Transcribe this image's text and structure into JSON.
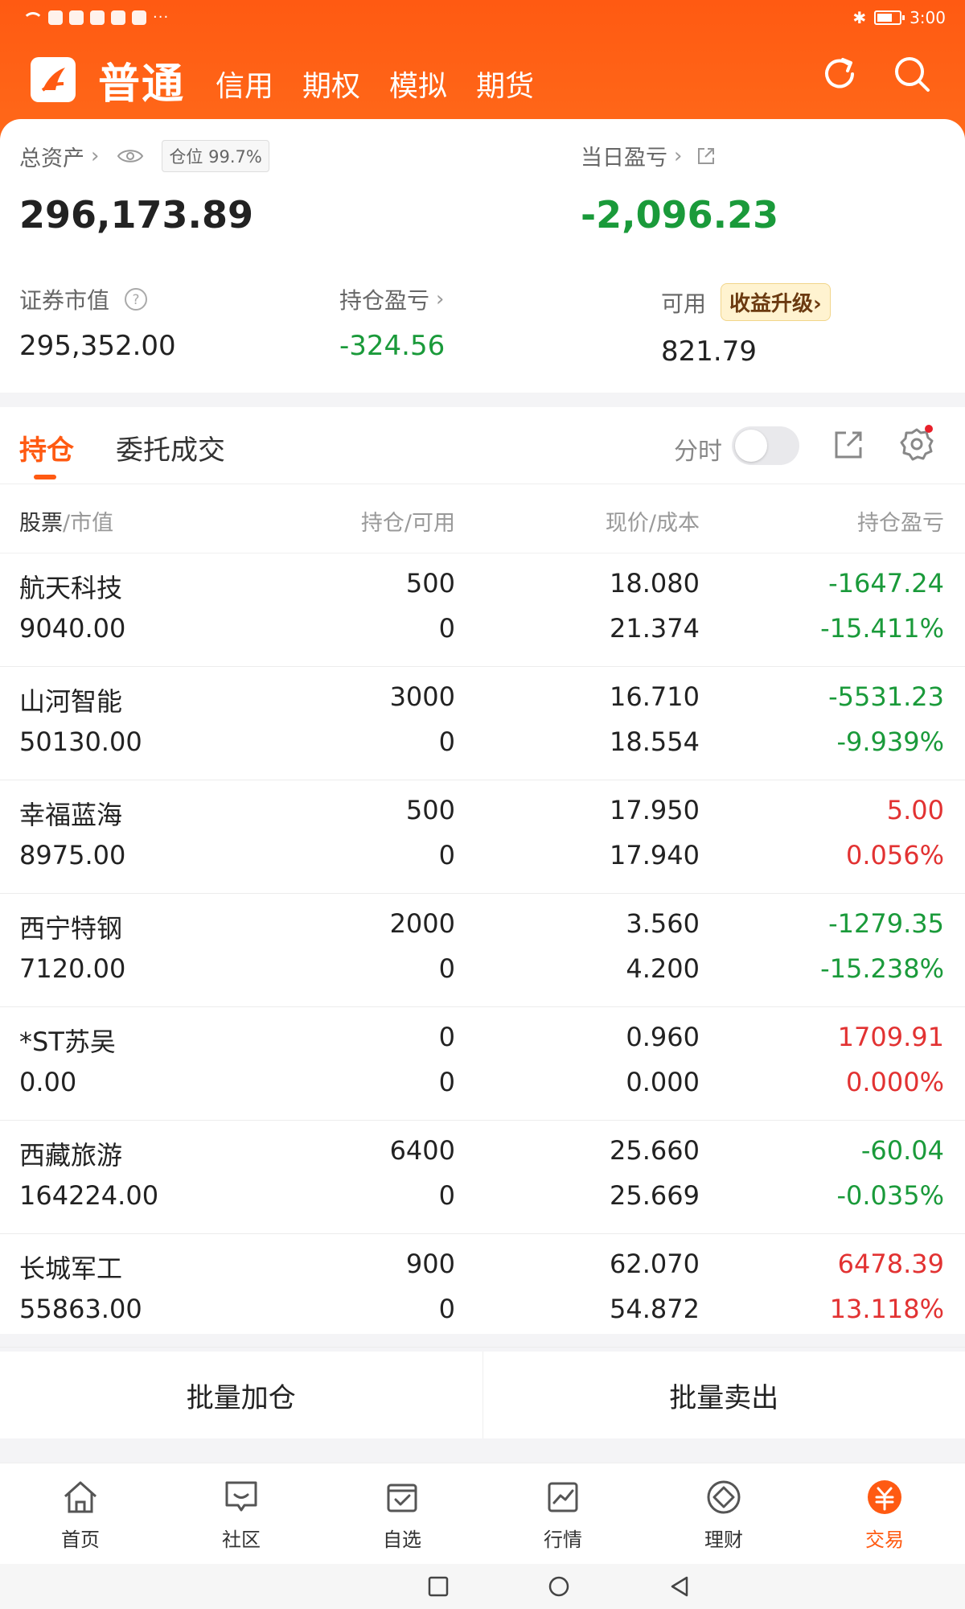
{
  "status_bar": {
    "time": "3:00",
    "dots": "···"
  },
  "nav": {
    "main": "普通",
    "tabs": [
      "信用",
      "期权",
      "模拟",
      "期货"
    ]
  },
  "account": {
    "total_assets_label": "总资产",
    "position_label": "仓位",
    "position_value": "99.7%",
    "total_assets_value": "296,173.89",
    "daily_pnl_label": "当日盈亏",
    "daily_pnl_value": "-2,096.23",
    "market_value_label": "证券市值",
    "market_value": "295,352.00",
    "holding_pnl_label": "持仓盈亏",
    "holding_pnl_value": "-324.56",
    "available_label": "可用",
    "available_value": "821.79",
    "upgrade_label": "收益升级"
  },
  "positions": {
    "tabs": [
      "持仓",
      "委托成交"
    ],
    "intraday_label": "分时",
    "columns": {
      "stock_part1": "股票",
      "stock_part2": "/市值",
      "holding": "持仓/可用",
      "price": "现价/成本",
      "pnl": "持仓盈亏"
    },
    "rows": [
      {
        "name": "航天科技",
        "market_value": "9040.00",
        "holding": "500",
        "available": "0",
        "price": "18.080",
        "cost": "21.374",
        "pnl": "-1647.24",
        "pnl_pct": "-15.411%",
        "direction": "down"
      },
      {
        "name": "山河智能",
        "market_value": "50130.00",
        "holding": "3000",
        "available": "0",
        "price": "16.710",
        "cost": "18.554",
        "pnl": "-5531.23",
        "pnl_pct": "-9.939%",
        "direction": "down"
      },
      {
        "name": "幸福蓝海",
        "market_value": "8975.00",
        "holding": "500",
        "available": "0",
        "price": "17.950",
        "cost": "17.940",
        "pnl": "5.00",
        "pnl_pct": "0.056%",
        "direction": "up"
      },
      {
        "name": "西宁特钢",
        "market_value": "7120.00",
        "holding": "2000",
        "available": "0",
        "price": "3.560",
        "cost": "4.200",
        "pnl": "-1279.35",
        "pnl_pct": "-15.238%",
        "direction": "down"
      },
      {
        "name": "*ST苏吴",
        "market_value": "0.00",
        "holding": "0",
        "available": "0",
        "price": "0.960",
        "cost": "0.000",
        "pnl": "1709.91",
        "pnl_pct": "0.000%",
        "direction": "up"
      },
      {
        "name": "西藏旅游",
        "market_value": "164224.00",
        "holding": "6400",
        "available": "0",
        "price": "25.660",
        "cost": "25.669",
        "pnl": "-60.04",
        "pnl_pct": "-0.035%",
        "direction": "down"
      },
      {
        "name": "长城军工",
        "market_value": "55863.00",
        "holding": "900",
        "available": "0",
        "price": "62.070",
        "cost": "54.872",
        "pnl": "6478.39",
        "pnl_pct": "13.118%",
        "direction": "up"
      }
    ]
  },
  "bulk_actions": {
    "add": "批量加仓",
    "sell": "批量卖出"
  },
  "bottom_nav": [
    "首页",
    "社区",
    "自选",
    "行情",
    "理财",
    "交易"
  ],
  "colors": {
    "brand": "#ff5a12",
    "up": "#e23232",
    "down": "#1a9a3a"
  },
  "icons": [
    "refresh-icon",
    "search-icon",
    "eye-icon",
    "help-icon",
    "external-link-icon",
    "settings-icon",
    "home-icon",
    "community-icon",
    "watchlist-icon",
    "market-icon",
    "wealth-icon",
    "trade-icon"
  ]
}
